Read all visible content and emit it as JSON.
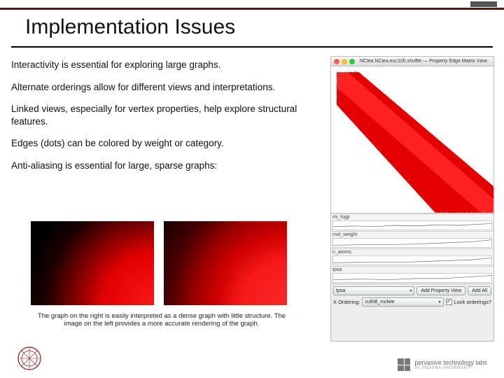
{
  "title": "Implementation Issues",
  "bullets": [
    "Interactivity is essential for exploring large graphs.",
    "Alternate orderings allow for different views and interpretations.",
    "Linked views, especially for vertex properties, help explore structural features.",
    "Edges (dots) can be colored by weight or category.",
    "Anti-aliasing is essential for large, sparse graphs:"
  ],
  "caption": "The graph on the right is easily interpreted as a dense graph with little structure.  The image on the left provides a more accurate rendering of the graph.",
  "window": {
    "title": "NClea.NClea.euc100.shuffle — Property Edge Matrix View",
    "properties": [
      "mi_logp",
      "mol_weight",
      "n_atoms",
      "tpsa"
    ],
    "prop_select": {
      "selected": "tpsa"
    },
    "buttons": {
      "add_prop": "Add Property View",
      "add_all": "Add All"
    },
    "ordering": {
      "label": "X Ordering:",
      "selected": "cuthill_mckee"
    },
    "lock": {
      "label": "Lock orderings?",
      "checked": true
    }
  },
  "footer": {
    "right_name": "pervasive technology labs",
    "right_sub": "AT INDIANA UNIVERSITY"
  }
}
